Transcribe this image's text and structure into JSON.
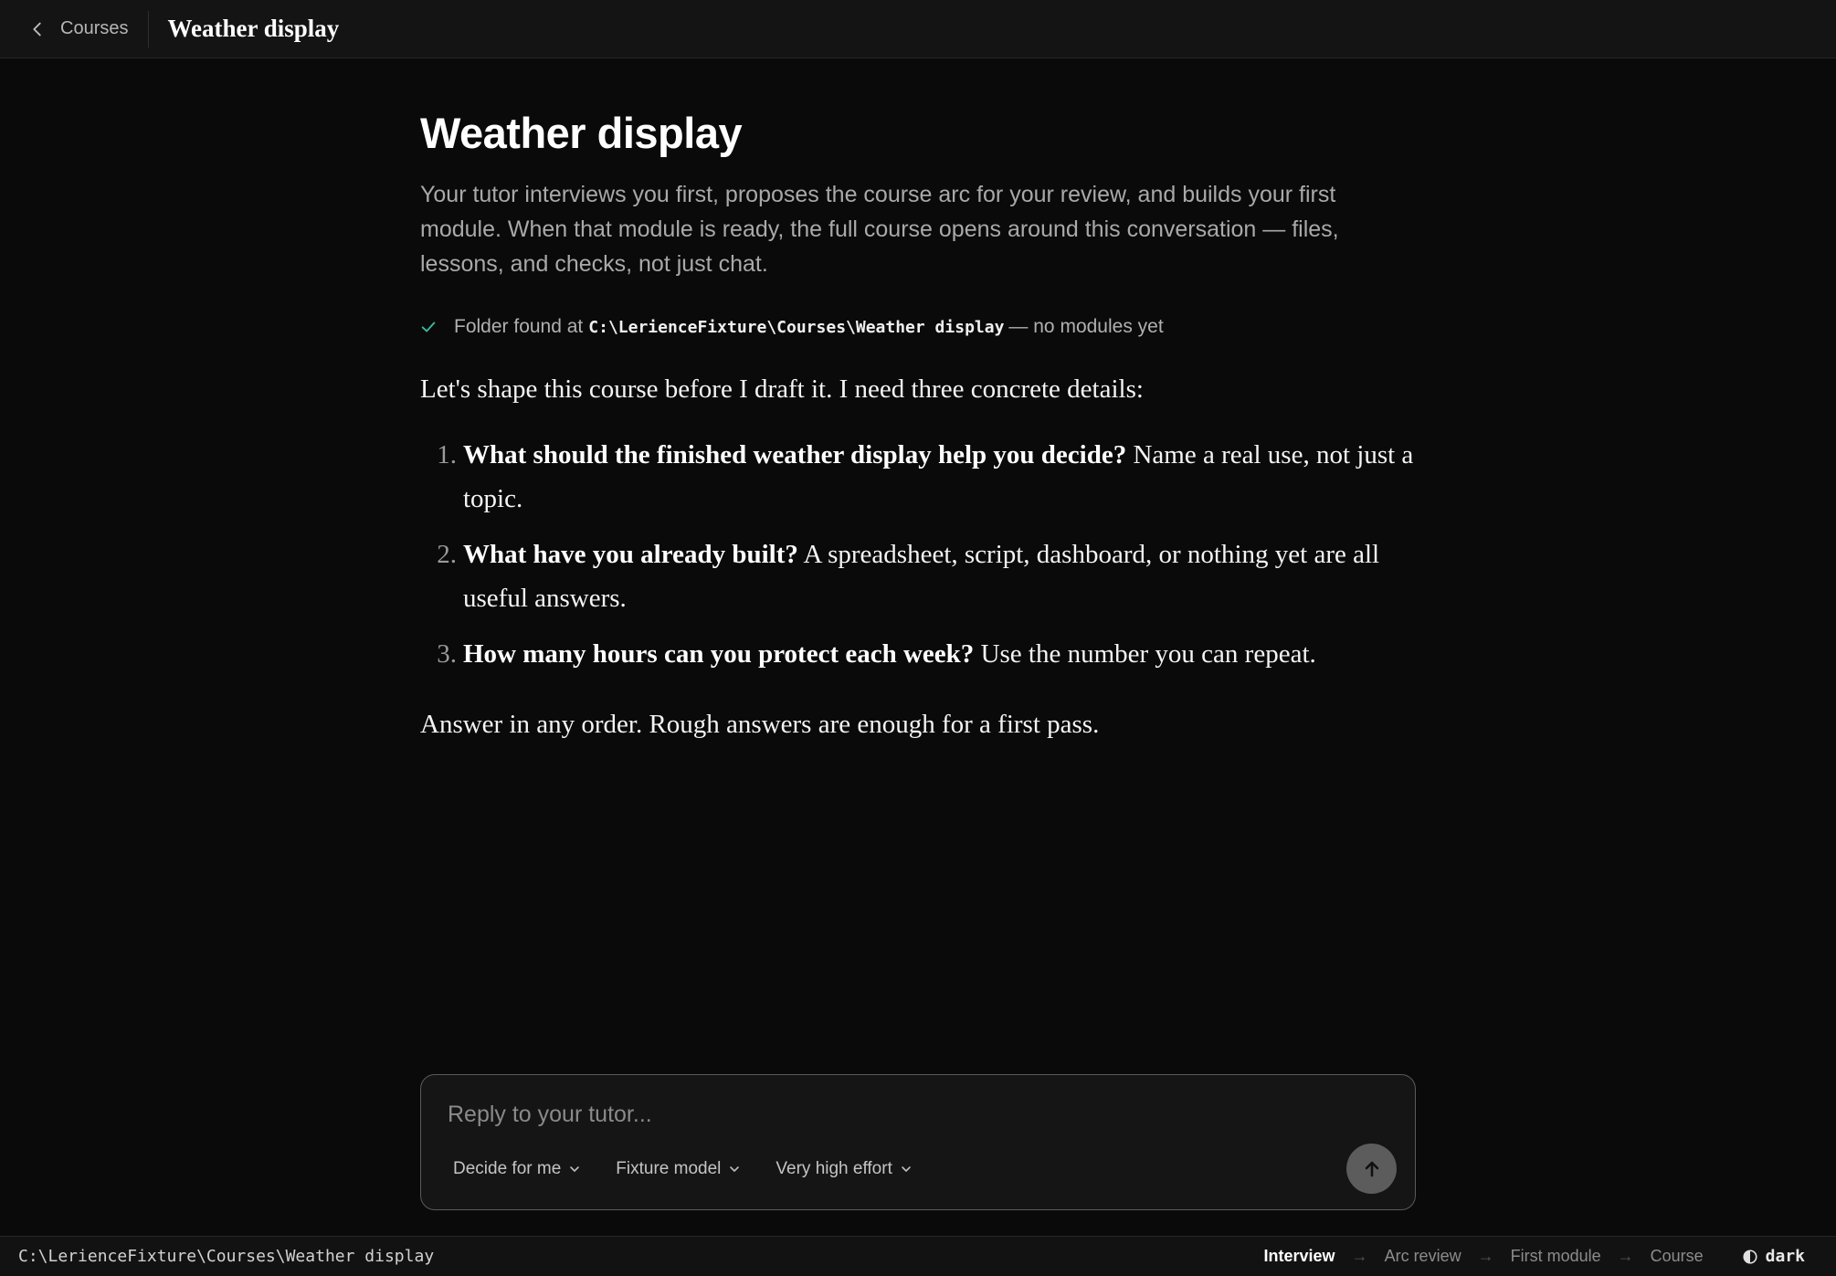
{
  "topbar": {
    "back_label": "Courses",
    "title": "Weather display"
  },
  "main": {
    "title": "Weather display",
    "intro": "Your tutor interviews you first, proposes the course arc for your review, and builds your first module. When that module is ready, the full course opens around this conversation — files, lessons, and checks, not just chat.",
    "status": {
      "prefix": "Folder found at",
      "path": "C:\\LerienceFixture\\Courses\\Weather display",
      "suffix": "— no modules yet"
    },
    "message": {
      "intro": "Let's shape this course before I draft it. I need three concrete details:",
      "questions": [
        {
          "num": "1.",
          "bold": "What should the finished weather display help you decide?",
          "rest": "Name a real use, not just a topic."
        },
        {
          "num": "2.",
          "bold": "What have you already built?",
          "rest": "A spreadsheet, script, dashboard, or nothing yet are all useful answers."
        },
        {
          "num": "3.",
          "bold": "How many hours can you protect each week?",
          "rest": "Use the number you can repeat."
        }
      ],
      "outro": "Answer in any order. Rough answers are enough for a first pass."
    }
  },
  "composer": {
    "placeholder": "Reply to your tutor...",
    "value": "",
    "options": [
      "Decide for me",
      "Fixture model",
      "Very high effort"
    ]
  },
  "statusbar": {
    "path": "C:\\LerienceFixture\\Courses\\Weather display",
    "steps": [
      "Interview",
      "Arc review",
      "First module",
      "Course"
    ],
    "current_step": "Interview",
    "arrow": "→",
    "theme_label": "dark"
  },
  "colors": {
    "background": "#0a0a0a",
    "accent_check": "#3fb39a",
    "send_button": "#5c5c5c"
  },
  "icons": {
    "back": "chevron-left-icon",
    "status": "check-icon",
    "dropdown": "chevron-down-icon",
    "send": "arrow-up-icon",
    "theme": "half-circle-icon"
  }
}
